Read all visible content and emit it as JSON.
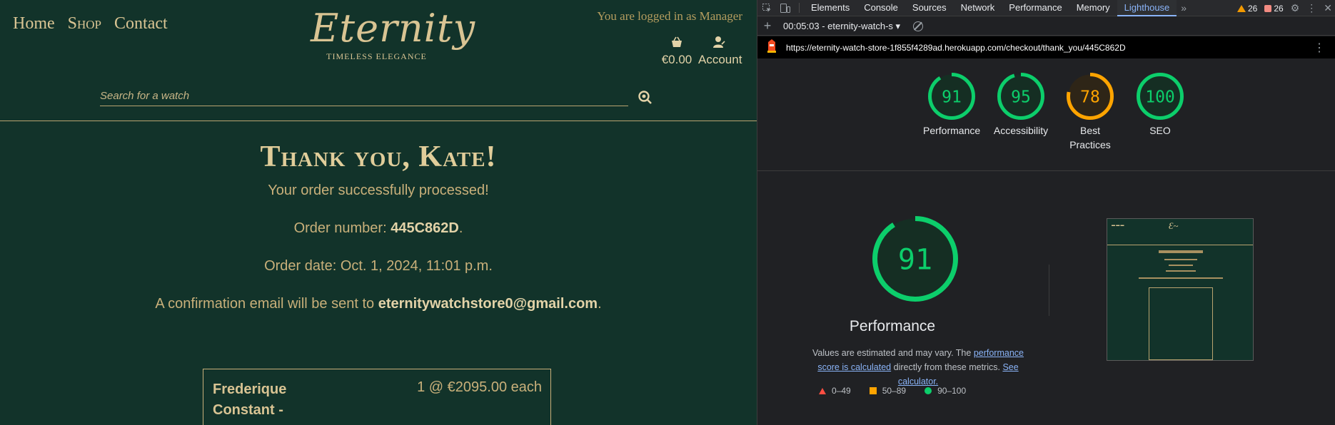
{
  "site": {
    "nav": [
      {
        "label": "Home"
      },
      {
        "label": "Shop"
      },
      {
        "label": "Contact"
      }
    ],
    "logo": {
      "text": "Eternity",
      "tagline": "TIMELESS ELEGANCE"
    },
    "logged_in_text": "You are logged in as Manager",
    "cart": {
      "icon": "basket-icon",
      "total": "€0.00"
    },
    "account": {
      "icon": "user-icon",
      "label": "Account"
    },
    "search": {
      "placeholder": "Search for a watch",
      "icon": "search-icon"
    },
    "thank_you": {
      "title": "Thank you, Kate!",
      "processed": "Your order successfully processed!",
      "order_prefix": "Order number: ",
      "order_number": "445C862D",
      "order_suffix": ".",
      "date_text": "Order date: Oct. 1, 2024, 11:01 p.m.",
      "email_prefix": "A confirmation email will be sent to ",
      "email": "eternitywatchstore0@gmail.com",
      "email_suffix": "."
    },
    "order_item": {
      "name": "Frederique Constant -",
      "qty_price": "1 @ €2095.00 each"
    }
  },
  "devtools": {
    "tabs": [
      "Elements",
      "Console",
      "Sources",
      "Network",
      "Performance",
      "Memory",
      "Lighthouse"
    ],
    "active_tab": "Lighthouse",
    "warnings_count": "26",
    "errors_count": "26",
    "toolbar": {
      "report_select": "00:05:03 - eternity-watch-s"
    },
    "url": "https://eternity-watch-store-1f855f4289ad.herokuapp.com/checkout/thank_you/445C862D",
    "scores": [
      {
        "label": "Performance",
        "value": 91
      },
      {
        "label": "Accessibility",
        "value": 95
      },
      {
        "label": "Best Practices",
        "value": 78
      },
      {
        "label": "SEO",
        "value": 100
      }
    ],
    "perf": {
      "score": 91,
      "title": "Performance",
      "desc_prefix": "Values are estimated and may vary. The ",
      "desc_link": "performance score is calculated",
      "desc_middle": " directly from these metrics. ",
      "desc_link2": "See calculator."
    },
    "legend": [
      {
        "range": "0–49"
      },
      {
        "range": "50–89"
      },
      {
        "range": "90–100"
      }
    ],
    "colors": {
      "good": "#0cce6b",
      "average": "#ffa400",
      "poor": "#ff4e42"
    }
  }
}
